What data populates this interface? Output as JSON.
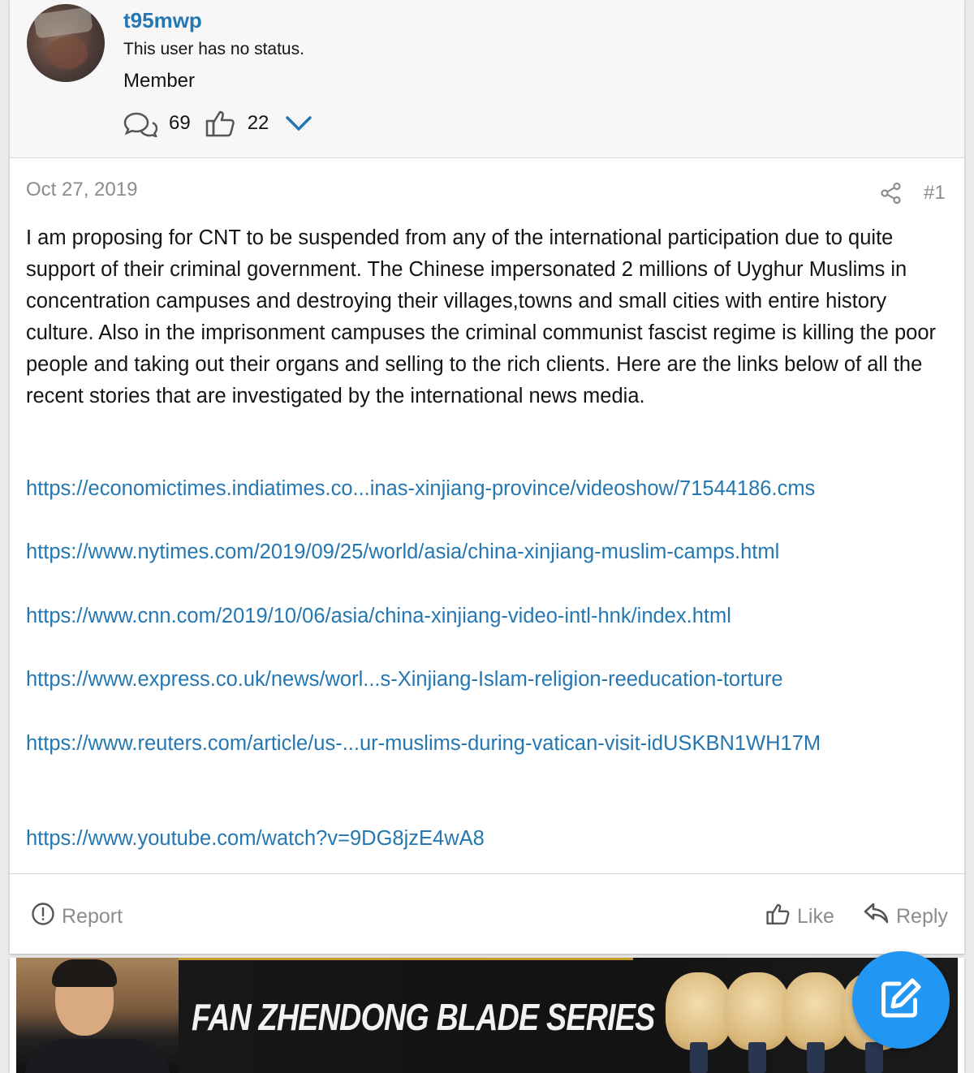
{
  "user": {
    "username": "t95mwp",
    "status": "This user has no status.",
    "role": "Member",
    "messages_count": "69",
    "reactions_count": "22"
  },
  "post": {
    "date": "Oct 27, 2019",
    "number": "#1",
    "message": "I am proposing for CNT to be suspended from any of the international participation due to quite support of their criminal government. The Chinese impersonated 2 millions of Uyghur Muslims in concentration campuses and destroying their villages,towns and small cities with entire history culture. Also in the imprisonment campuses the criminal communist fascist regime is killing the poor people and taking out their organs and selling to the rich clients. Here are the links below of all the recent stories that are investigated by the international news media.",
    "links": [
      "https://economictimes.indiatimes.co...inas-xinjiang-province/videoshow/71544186.cms",
      "https://www.nytimes.com/2019/09/25/world/asia/china-xinjiang-muslim-camps.html",
      "https://www.cnn.com/2019/10/06/asia/china-xinjiang-video-intl-hnk/index.html",
      "https://www.express.co.uk/news/worl...s-Xinjiang-Islam-religion-reeducation-torture",
      "https://www.reuters.com/article/us-...ur-muslims-during-vatican-visit-idUSKBN1WH17M",
      "https://www.youtube.com/watch?v=9DG8jzE4wA8"
    ]
  },
  "actions": {
    "report": "Report",
    "like": "Like",
    "reply": "Reply"
  },
  "banner": {
    "title": "FAN ZHENDONG BLADE SERIES"
  },
  "colors": {
    "link": "#2577b1",
    "muted": "#8c8c8c",
    "fab": "#2196f3"
  }
}
